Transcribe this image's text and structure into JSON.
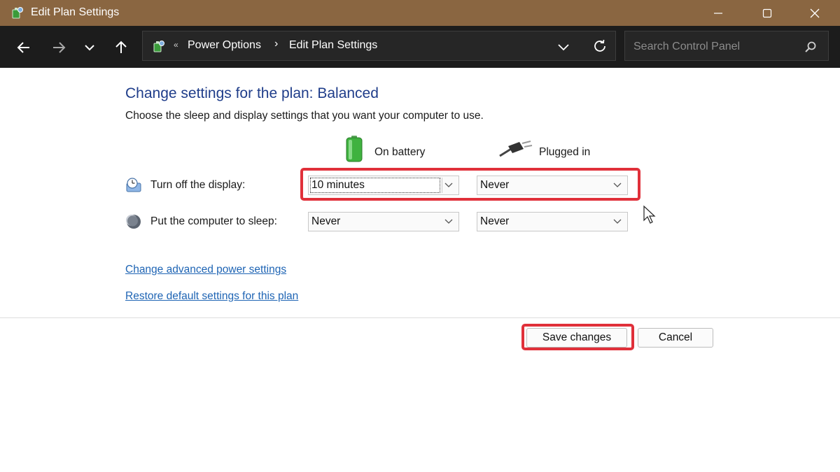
{
  "window": {
    "title": "Edit Plan Settings",
    "title_bar_color": "#8a6641"
  },
  "nav": {
    "breadcrumb_prefix": "«",
    "breadcrumbs": [
      "Power Options",
      "Edit Plan Settings"
    ],
    "breadcrumb_separator": "›",
    "search_placeholder": "Search Control Panel"
  },
  "main": {
    "title": "Change settings for the plan: Balanced",
    "subtitle": "Choose the sleep and display settings that you want your computer to use.",
    "columns": {
      "battery": "On battery",
      "plugged": "Plugged in"
    },
    "rows": [
      {
        "label": "Turn off the display:",
        "battery_value": "10 minutes",
        "plugged_value": "Never"
      },
      {
        "label": "Put the computer to sleep:",
        "battery_value": "Never",
        "plugged_value": "Never"
      }
    ],
    "links": {
      "advanced": "Change advanced power settings",
      "restore": "Restore default settings for this plan"
    }
  },
  "buttons": {
    "save": "Save changes",
    "cancel": "Cancel"
  },
  "colors": {
    "title_text": "#1f3d8a",
    "link_text": "#1e64b4",
    "highlight": "#e0303a"
  }
}
